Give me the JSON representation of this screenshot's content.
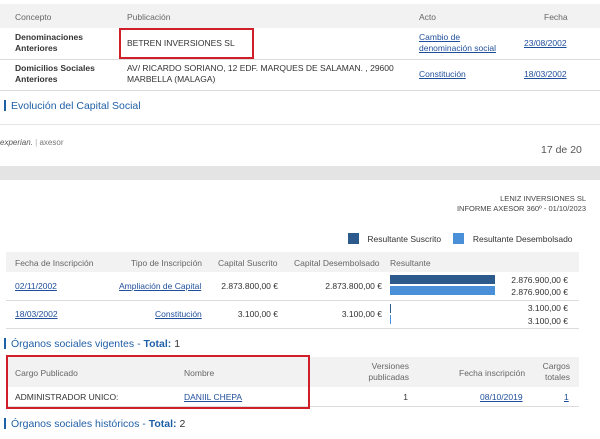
{
  "page1": {
    "table": {
      "headers": {
        "concepto": "Concepto",
        "publicacion": "Publicación",
        "acto": "Acto",
        "fecha": "Fecha"
      },
      "rows": [
        {
          "concepto_line1": "Denominaciones",
          "concepto_line2": "Anteriores",
          "publicacion": "BETREN INVERSIONES SL",
          "acto_line1": "Cambio de",
          "acto_line2": "denominación social",
          "fecha": "23/08/2002"
        },
        {
          "concepto_line1": "Domicilios Sociales",
          "concepto_line2": "Anteriores",
          "publicacion_line1": "AV/ RICARDO SORIANO, 12 EDF. MARQUES DE SALAMAN. , 29600",
          "publicacion_line2": "MARBELLA  (MALAGA)",
          "acto": "Constitución",
          "fecha": "18/03/2002"
        }
      ]
    },
    "section_title": "Evolución del Capital Social",
    "footer": {
      "brand1": "experian.",
      "brand2": "axesor",
      "page": "17 de 20"
    }
  },
  "page2": {
    "header": {
      "company": "LENIZ INVERSIONES SL",
      "report": "INFORME AXESOR 360º - 01/10/2023"
    },
    "legend": {
      "items": [
        {
          "label": "Resultante Suscrito",
          "color": "#2c5a8c"
        },
        {
          "label": "Resultante Desembolsado",
          "color": "#4a90d9"
        }
      ]
    },
    "capital_table": {
      "headers": {
        "fecha": "Fecha de Inscripción",
        "tipo": "Tipo de Inscripción",
        "suscrito": "Capital Suscrito",
        "desembolsado": "Capital Desembolsado",
        "resultante": "Resultante"
      },
      "rows": [
        {
          "fecha": "02/11/2002",
          "tipo": "Ampliación de Capital",
          "suscrito": "2.873.800,00 €",
          "desembolsado": "2.873.800,00 €",
          "res_suscrito": "2.876.900,00 €",
          "res_desembolsado": "2.876.900,00 €"
        },
        {
          "fecha": "18/03/2002",
          "tipo": "Constitución",
          "suscrito": "3.100,00 €",
          "desembolsado": "3.100,00 €",
          "res_suscrito": "3.100,00 €",
          "res_desembolsado": "3.100,00 €"
        }
      ]
    },
    "organos_vigentes": {
      "title": "Órganos sociales vigentes - ",
      "total_label": "Total:",
      "total": "1",
      "headers": {
        "cargo": "Cargo Publicado",
        "nombre": "Nombre",
        "versiones_line1": "Versiones",
        "versiones_line2": "publicadas",
        "fecha": "Fecha inscripción",
        "cargos_line1": "Cargos",
        "cargos_line2": "totales"
      },
      "rows": [
        {
          "cargo": "ADMINISTRADOR UNICO:",
          "nombre": "DANIIL CHEPA",
          "versiones": "1",
          "fecha": "08/10/2019",
          "cargos": "1"
        }
      ]
    },
    "organos_historicos": {
      "title": "Órganos sociales históricos - ",
      "total_label": "Total:",
      "total": "2"
    }
  }
}
